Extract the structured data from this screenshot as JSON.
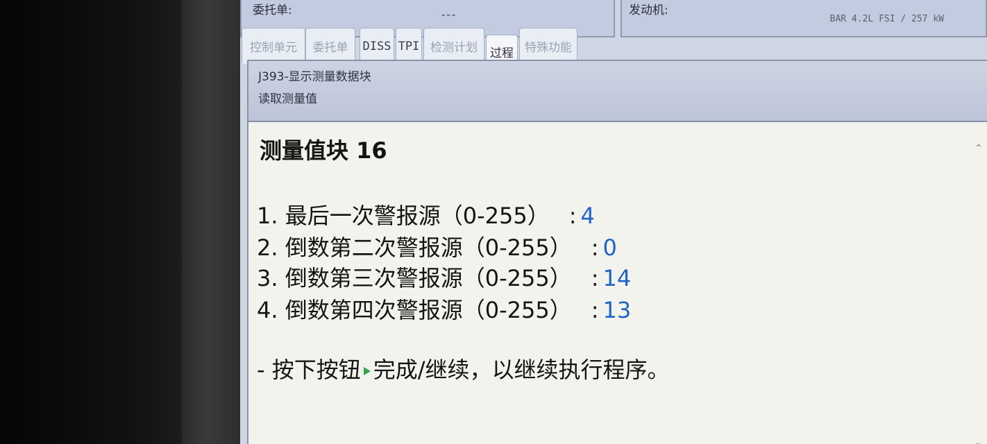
{
  "header": {
    "order_label": "委托单:",
    "order_value": "---",
    "engine_label": "发动机:",
    "engine_info": "BAR 4.2L FSI / 257 kW"
  },
  "tabs": [
    {
      "label": "控制单元",
      "active": false
    },
    {
      "label": "委托单",
      "active": false
    },
    {
      "label": "DISS",
      "active": false
    },
    {
      "label": "TPI",
      "active": false
    },
    {
      "label": "检测计划",
      "active": false
    },
    {
      "label": "过程",
      "active": true
    },
    {
      "label": "特殊功能",
      "active": false
    }
  ],
  "procedure": {
    "title": "J393-显示测量数据块",
    "subtitle": "读取测量值"
  },
  "block": {
    "title": "测量值块",
    "number": "16",
    "rows": [
      {
        "label": "1. 最后一次警报源（0-255）",
        "value": "4"
      },
      {
        "label": "2. 倒数第二次警报源（0-255）",
        "value": "0"
      },
      {
        "label": "3. 倒数第三次警报源（0-255）",
        "value": "14"
      },
      {
        "label": "4. 倒数第四次警报源（0-255）",
        "value": "13"
      }
    ],
    "instruction_prefix": "- 按下按钮",
    "instruction_suffix": "完成/继续，以继续执行程序。"
  },
  "colors": {
    "value_blue": "#1f63c9",
    "play_green": "#3aa04a"
  },
  "icons": {
    "play": "play-triangle-icon",
    "scroll_up": "chevron-up-icon",
    "scroll_down": "chevron-down-icon"
  }
}
